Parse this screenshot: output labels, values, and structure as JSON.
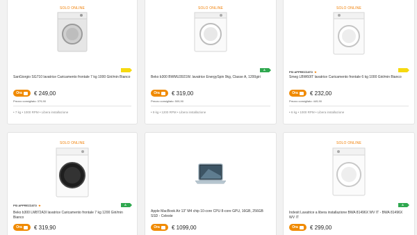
{
  "products": [
    {
      "badge": "SOLO ONLINE",
      "title": "SanGiorgio SG710 lavatrice Caricamento frontale 7 kg 1000 Giri/min Bianco",
      "energy": "",
      "energy_color": "#f6d90f",
      "promo": "Ora",
      "price": "€ 249,00",
      "rrp": "Prezzo consigliato: 379,90",
      "spec": "• 7 kg • 1000 RPM • Libera installazione",
      "image": "front-load-washer-grey-door"
    },
    {
      "badge": "SOLO ONLINE",
      "title": "Beko b300 BWMU3921W. lavatrice EnergySpin 9kg, Classe A, 1200giri",
      "energy": "A",
      "energy_color": "#2fa84f",
      "promo": "Ora",
      "price": "€ 319,00",
      "rrp": "Prezzo consigliato: 509,90",
      "spec": "• 9 kg • 1200 RPM • Libera installazione",
      "image": "front-load-washer-white"
    },
    {
      "badge": "SOLO ONLINE",
      "seller": "PSI APPREZZATO",
      "title": "Smeg LBW60IT lavatrice Caricamento frontale 6 kg 1000 Giri/min Bianco",
      "energy": "",
      "energy_color": "#f6d90f",
      "promo": "Ora",
      "price": "€ 232,00",
      "rrp": "Prezzo consigliato: 449,90",
      "spec": "• 6 kg • 1000 RPM • Libera installazione",
      "image": "front-load-washer-white-round"
    },
    {
      "badge": "SOLO ONLINE",
      "seller": "PSI APPREZZATO",
      "title": "Beko b300 LM872A3I lavatrice Caricamento frontale 7 kg 1200 Giri/min Bianco",
      "energy": "A",
      "energy_color": "#2fa84f",
      "promo": "Ora",
      "price": "€ 319,90",
      "image": "front-load-washer-black-door"
    },
    {
      "badge": "",
      "title": "Apple MacBook Air 13\" M4 chip 10-core CPU 8-core GPU, 16GB, 256GB SSD - Celeste",
      "energy": "",
      "promo": "Ora",
      "price": "€ 1099,00",
      "image": "laptop"
    },
    {
      "badge": "SOLO ONLINE",
      "title": "Indesit Lavatrice a libera installazione BWA 81496X WV IT - BWA 81496X WV IT",
      "energy": "A",
      "energy_color": "#2fa84f",
      "promo": "Ora",
      "price": "€ 299,00",
      "image": "front-load-washer-white-indesit"
    }
  ]
}
